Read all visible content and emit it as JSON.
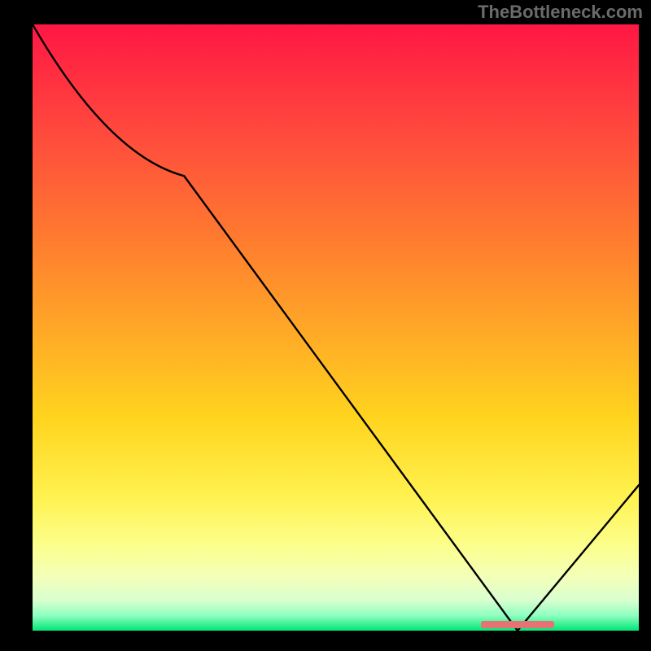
{
  "attribution": "TheBottleneck.com",
  "chart_data": {
    "type": "line",
    "title": "",
    "xlabel": "",
    "ylabel": "",
    "xlim": [
      0,
      100
    ],
    "ylim": [
      0,
      100
    ],
    "series": [
      {
        "name": "bottleneck-curve",
        "x": [
          0,
          25,
          80,
          100
        ],
        "values": [
          100,
          75,
          0,
          24
        ]
      }
    ],
    "marker": {
      "name": "optimal-range",
      "x_start": 74,
      "x_end": 86,
      "y": 1
    },
    "gradient_stops": [
      {
        "pos": 0,
        "color": "#ff1744"
      },
      {
        "pos": 0.18,
        "color": "#ff4a3d"
      },
      {
        "pos": 0.35,
        "color": "#ff7a2f"
      },
      {
        "pos": 0.52,
        "color": "#ffad26"
      },
      {
        "pos": 0.65,
        "color": "#ffd41e"
      },
      {
        "pos": 0.78,
        "color": "#fff250"
      },
      {
        "pos": 0.86,
        "color": "#fcff8c"
      },
      {
        "pos": 0.91,
        "color": "#f4ffb8"
      },
      {
        "pos": 0.95,
        "color": "#d9ffcf"
      },
      {
        "pos": 0.975,
        "color": "#8fffc0"
      },
      {
        "pos": 1.0,
        "color": "#00e676"
      }
    ]
  }
}
